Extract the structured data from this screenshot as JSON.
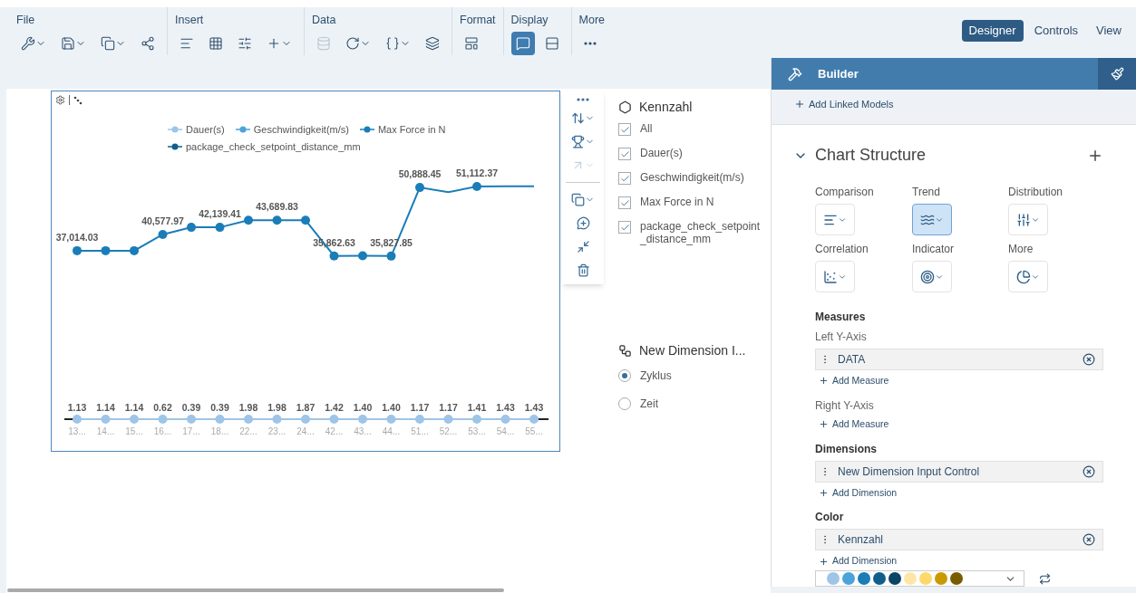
{
  "toolbar": {
    "groups": [
      {
        "label": "File",
        "buttons": [
          {
            "caret": true,
            "disabled": false,
            "selected": false
          },
          {
            "caret": true,
            "disabled": false,
            "selected": false
          },
          {
            "caret": true,
            "disabled": false,
            "selected": false
          },
          {
            "caret": false,
            "disabled": false,
            "selected": false
          }
        ]
      },
      {
        "label": "Insert",
        "buttons": [
          {
            "caret": false,
            "disabled": false,
            "selected": false
          },
          {
            "caret": false,
            "disabled": false,
            "selected": false
          },
          {
            "caret": false,
            "disabled": false,
            "selected": false
          },
          {
            "caret": true,
            "disabled": false,
            "selected": false
          }
        ]
      },
      {
        "label": "Data",
        "buttons": [
          {
            "caret": false,
            "disabled": true,
            "selected": false
          },
          {
            "caret": true,
            "disabled": false,
            "selected": false
          },
          {
            "caret": true,
            "disabled": false,
            "selected": false
          },
          {
            "caret": false,
            "disabled": false,
            "selected": false
          }
        ]
      },
      {
        "label": "Format",
        "buttons": [
          {
            "caret": false,
            "disabled": false,
            "selected": false
          }
        ]
      },
      {
        "label": "Display",
        "buttons": [
          {
            "caret": false,
            "disabled": false,
            "selected": true
          },
          {
            "caret": false,
            "disabled": false,
            "selected": false
          }
        ]
      },
      {
        "label": "More",
        "buttons": [
          {
            "caret": false,
            "disabled": false,
            "selected": false
          }
        ]
      }
    ],
    "modes": [
      {
        "label": "Designer",
        "selected": true
      },
      {
        "label": "Controls",
        "selected": false
      },
      {
        "label": "View",
        "selected": false
      }
    ]
  },
  "chart": {
    "legend_extra": [
      {
        "label": "Geschwindigkeit(m/s)",
        "color": "#4da3d9"
      },
      {
        "label": "package_check_setpoint_distance_mm",
        "color": "#0f5f8c"
      }
    ],
    "chart_data": {
      "type": "line",
      "categories": [
        "13...",
        "14...",
        "15...",
        "16...",
        "17...",
        "18...",
        "22...",
        "23...",
        "24...",
        "42...",
        "43...",
        "44...",
        "51...",
        "52...",
        "53...",
        "54...",
        "55..."
      ],
      "series": [
        {
          "name": "Max Force in N",
          "color": "#1a7db8",
          "marker": true,
          "values": [
            37014.03,
            37014,
            37014,
            40577.97,
            42139,
            42139.41,
            43690,
            43689.83,
            43690,
            35862.63,
            35900,
            35827.85,
            50888.45,
            49880,
            51112.37,
            51150,
            51150
          ],
          "value_labels": [
            "37,014.03",
            null,
            null,
            "40,577.97",
            null,
            "42,139.41",
            null,
            "43,689.83",
            null,
            "35,862.63",
            null,
            "35,827.85",
            "50,888.45",
            null,
            "51,112.37",
            null,
            null
          ]
        },
        {
          "name": "Dauer(s)",
          "color": "#9ec5e8",
          "marker": true,
          "values": [
            1.13,
            1.14,
            1.14,
            0.62,
            0.39,
            0.39,
            1.98,
            1.98,
            1.87,
            1.42,
            1.4,
            1.4,
            1.17,
            1.17,
            1.41,
            1.43,
            1.43
          ],
          "value_labels": [
            "1.13",
            "1.14",
            "1.14",
            "0.62",
            "0.39",
            "0.39",
            "1.98",
            "1.98",
            "1.87",
            "1.42",
            "1.40",
            "1.40",
            "1.17",
            "1.17",
            "1.41",
            "1.43",
            "1.43"
          ]
        }
      ]
    }
  },
  "float_toolbar": [
    {
      "caret": false,
      "disabled": false
    },
    {
      "caret": true,
      "disabled": false
    },
    {
      "caret": true,
      "disabled": false
    },
    {
      "caret": true,
      "disabled": true
    },
    {
      "caret": true,
      "disabled": false
    },
    {
      "caret": false,
      "disabled": false
    },
    {
      "caret": false,
      "disabled": false
    },
    {
      "caret": false,
      "disabled": false
    }
  ],
  "measure_filter": {
    "title": "Kennzahl",
    "items": [
      {
        "label": "All",
        "checked": true
      },
      {
        "label": "Dauer(s)",
        "checked": true
      },
      {
        "label": "Geschwindigkeit(m/s)",
        "checked": true
      },
      {
        "label": "Max Force in N",
        "checked": true
      },
      {
        "label": "package_check_setpoint_distance_mm",
        "checked": true
      }
    ]
  },
  "dimension_filter": {
    "title": "New Dimension I...",
    "options": [
      {
        "label": "Zyklus",
        "selected": true
      },
      {
        "label": "Zeit",
        "selected": false
      }
    ]
  },
  "builder": {
    "title": "Builder",
    "add_linked": "Add Linked Models",
    "section": {
      "title": "Chart Structure",
      "expanded": true
    },
    "chart_types": [
      {
        "label": "Comparison",
        "selected": false
      },
      {
        "label": "Trend",
        "selected": true
      },
      {
        "label": "Distribution",
        "selected": false
      },
      {
        "label": "Correlation",
        "selected": false
      },
      {
        "label": "Indicator",
        "selected": false
      },
      {
        "label": "More",
        "selected": false
      }
    ],
    "groups": [
      {
        "heading": "Measures",
        "sub": "Left Y-Axis",
        "items": [
          "DATA"
        ],
        "add": "Add Measure"
      },
      {
        "sub": "Right Y-Axis",
        "add": "Add Measure"
      },
      {
        "heading": "Dimensions",
        "items": [
          "New Dimension Input Control"
        ],
        "add": "Add Dimension"
      },
      {
        "heading": "Color",
        "items": [
          "Kennzahl"
        ],
        "add": "Add Dimension"
      }
    ],
    "palette": [
      {
        "color": "#9ec5e8"
      },
      {
        "color": "#4da3d9"
      },
      {
        "color": "#1a7db8"
      },
      {
        "color": "#0f5f8c"
      },
      {
        "color": "#0b4566"
      },
      {
        "color": "#fde6a7"
      },
      {
        "color": "#fcd96b"
      },
      {
        "color": "#c99a00"
      },
      {
        "color": "#7a5c00"
      }
    ]
  }
}
